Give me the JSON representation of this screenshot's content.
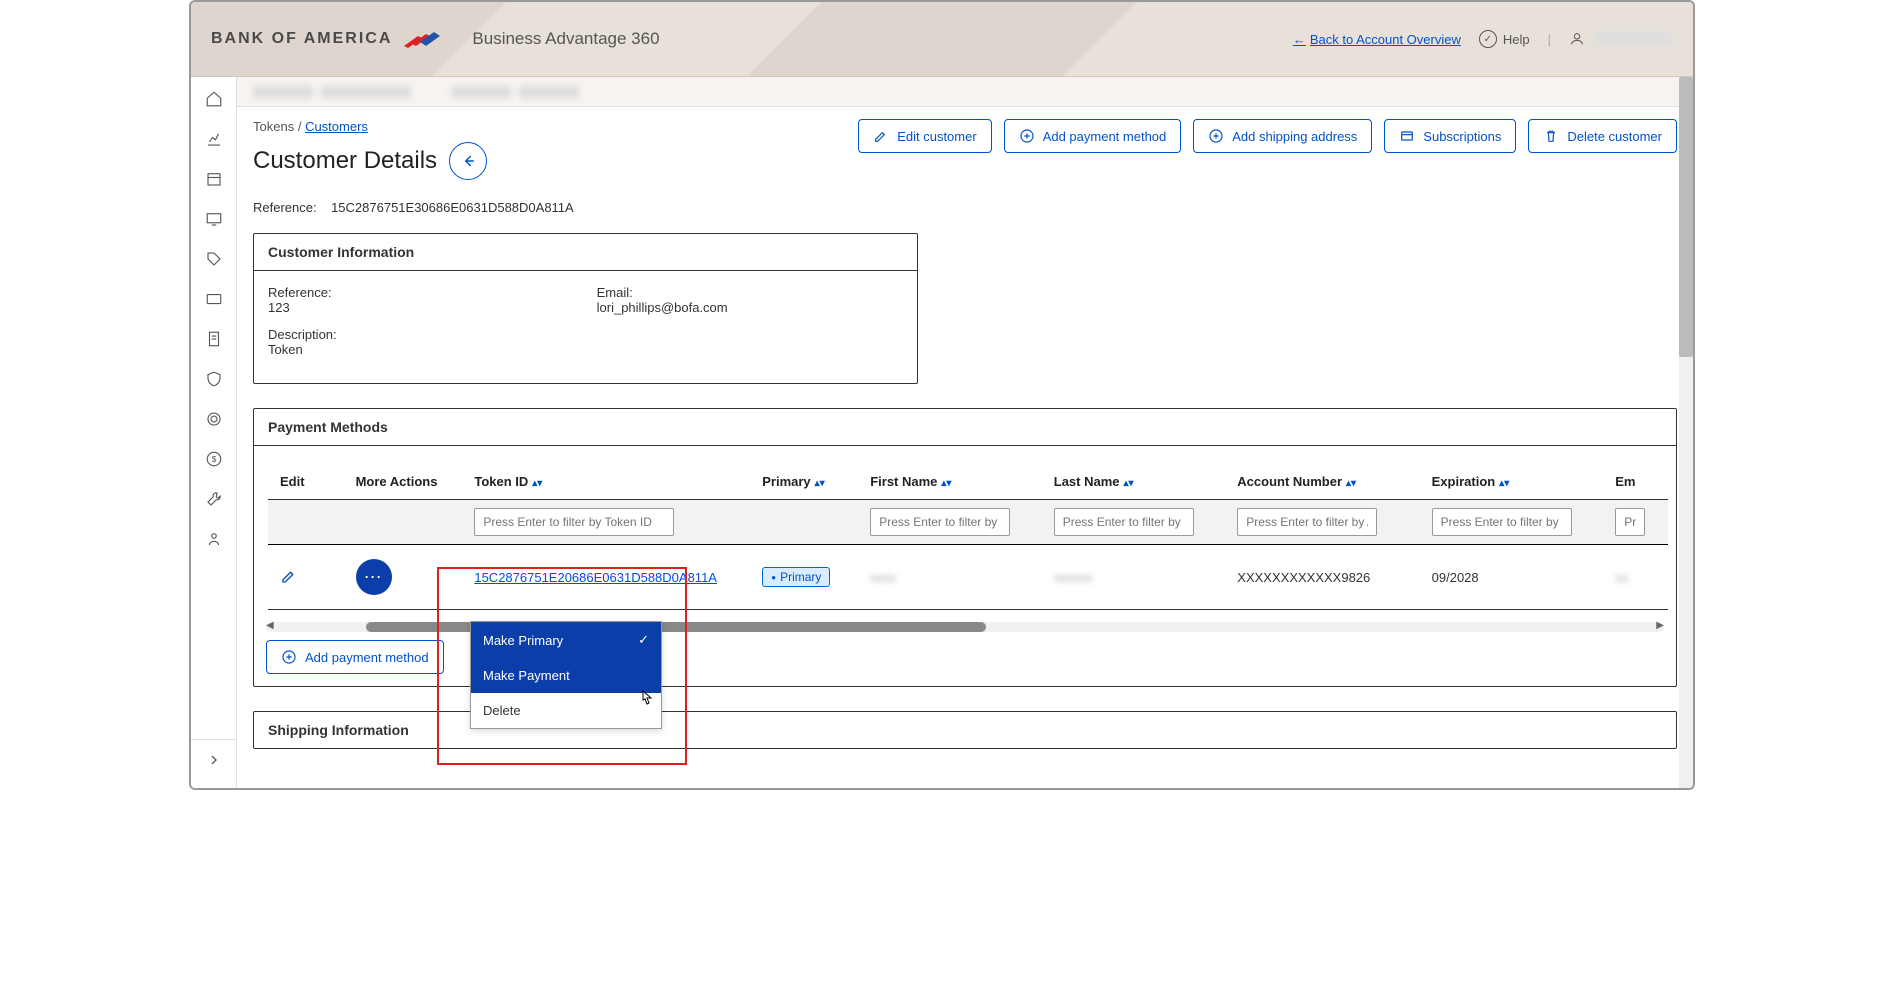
{
  "banner": {
    "logo_text": "BANK OF AMERICA",
    "product_name": "Business Advantage 360",
    "back_link": "Back to Account Overview",
    "help_label": "Help"
  },
  "breadcrumb": {
    "root": "Tokens",
    "current": "Customers"
  },
  "actions": {
    "edit_customer": "Edit customer",
    "add_payment": "Add payment method",
    "add_shipping": "Add shipping address",
    "subscriptions": "Subscriptions",
    "delete_customer": "Delete customer"
  },
  "page": {
    "title": "Customer Details",
    "ref_label": "Reference:",
    "ref_value": "15C2876751E30686E0631D588D0A811A"
  },
  "customer_info": {
    "header": "Customer Information",
    "reference_label": "Reference:",
    "reference_value": "123",
    "description_label": "Description:",
    "description_value": "Token",
    "email_label": "Email:",
    "email_value": "lori_phillips@bofa.com"
  },
  "payment_methods": {
    "header": "Payment Methods",
    "columns": {
      "edit": "Edit",
      "more_actions": "More Actions",
      "token_id": "Token ID",
      "primary": "Primary",
      "first_name": "First Name",
      "last_name": "Last Name",
      "account_number": "Account Number",
      "expiration": "Expiration",
      "email": "Em"
    },
    "filters": {
      "token_id": "Press Enter to filter by Token ID",
      "first_name": "Press Enter to filter by First",
      "last_name": "Press Enter to filter by Last",
      "account_number": "Press Enter to filter by Acco",
      "expiration": "Press Enter to filter by Expir",
      "email": "Pr"
    },
    "row": {
      "token_id": "15C2876751E20686E0631D588D0A811A",
      "primary_badge": "Primary",
      "account_number": "XXXXXXXXXXXX9826",
      "expiration": "09/2028"
    },
    "add_payment_method": "Add payment method"
  },
  "more_actions_menu": {
    "make_primary": "Make Primary",
    "make_payment": "Make Payment",
    "delete": "Delete"
  },
  "shipping": {
    "header": "Shipping Information"
  }
}
